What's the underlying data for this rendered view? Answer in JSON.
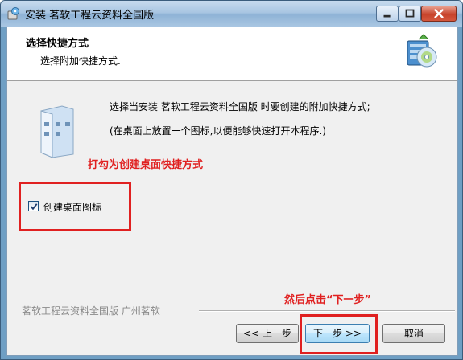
{
  "window": {
    "title": "安装 茗软工程云资料全国版"
  },
  "header": {
    "title": "选择快捷方式",
    "subtitle": "选择附加快捷方式."
  },
  "body": {
    "description_line1": "选择当安装 茗软工程云资料全国版 时要创建的附加快捷方式;",
    "description_line2": "(在桌面上放置一个图标,以便能够快速打开本程序.)",
    "checkbox": {
      "label": "创建桌面图标",
      "checked": true
    }
  },
  "annotations": {
    "checkbox_hint": "打勾为创建桌面快捷方式",
    "next_hint": "然后点击“下一步”",
    "color": "#e02020"
  },
  "footer": {
    "brand": "茗软工程云资料全国版  广州茗软"
  },
  "buttons": {
    "back": "<< 上一步",
    "next": "下一步 >>",
    "cancel": "取消"
  },
  "icons": {
    "app": "installer-icon",
    "header": "install-disc-icon",
    "shortcut": "shortcut-folder-icon"
  }
}
